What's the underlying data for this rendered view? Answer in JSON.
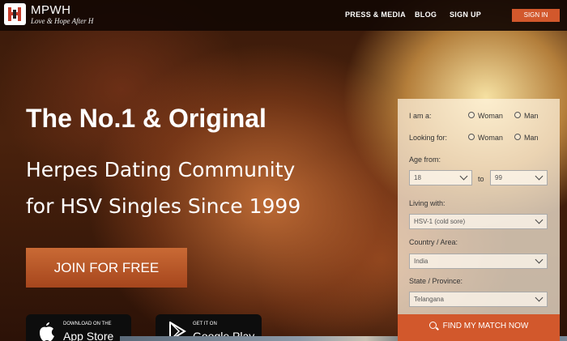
{
  "header": {
    "logo_name": "MPWH",
    "logo_tagline": "Love & Hope After H",
    "nav": [
      "PRESS & MEDIA",
      "BLOG",
      "SIGN UP"
    ],
    "signin_label": "SIGN IN"
  },
  "hero": {
    "headline": "The No.1 & Original",
    "subline1": "Herpes Dating Community",
    "subline2": "for HSV Singles Since 1999",
    "join_label": "JOIN FOR FREE"
  },
  "stores": {
    "apple": {
      "small": "DOWNLOAD ON THE",
      "big": "App Store"
    },
    "google": {
      "small": "GET IT ON",
      "big": "Google Play"
    }
  },
  "form": {
    "i_am_label": "I am a:",
    "looking_for_label": "Looking for:",
    "woman_label": "Woman",
    "man_label": "Man",
    "age_from_label": "Age from:",
    "age_from_value": "18",
    "to_label": "to",
    "age_to_value": "99",
    "living_with_label": "Living with:",
    "living_with_value": "HSV-1 (cold sore)",
    "country_label": "Country / Area:",
    "country_value": "India",
    "state_label": "State / Province:",
    "state_value": "Telangana",
    "find_label": "FIND MY MATCH NOW"
  },
  "colors": {
    "accent": "#d2582c",
    "topbar": "#140803"
  }
}
